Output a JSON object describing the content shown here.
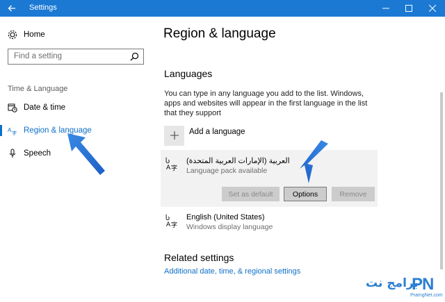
{
  "window": {
    "title": "Settings"
  },
  "sidebar": {
    "home_label": "Home",
    "search_placeholder": "Find a setting",
    "section_header": "Time & Language",
    "items": [
      {
        "label": "Date & time",
        "icon": "calendar-clock-icon"
      },
      {
        "label": "Region & language",
        "icon": "region-language-icon",
        "active": true
      },
      {
        "label": "Speech",
        "icon": "microphone-icon"
      }
    ]
  },
  "main": {
    "title": "Region & language",
    "languages_heading": "Languages",
    "languages_description": "You can type in any language you add to the list. Windows, apps and websites will appear in the first language in the list that they support",
    "add_language_label": "Add a language",
    "languages": [
      {
        "name": "العربية (الإمارات العربية المتحدة)",
        "status": "Language pack available",
        "selected": true
      },
      {
        "name": "English (United States)",
        "status": "Windows display language",
        "selected": false
      }
    ],
    "buttons": {
      "set_default": "Set as default",
      "options": "Options",
      "remove": "Remove"
    },
    "related_heading": "Related settings",
    "related_link": "Additional date, time, & regional settings"
  },
  "watermark": {
    "arabic": "برامج نت",
    "logo": "PN",
    "site": "PramgNet.com"
  },
  "colors": {
    "titlebar": "#1b79d4",
    "accent": "#0e6fc7",
    "card": "#f2f2f2",
    "disabled_button": "#cccccc"
  }
}
